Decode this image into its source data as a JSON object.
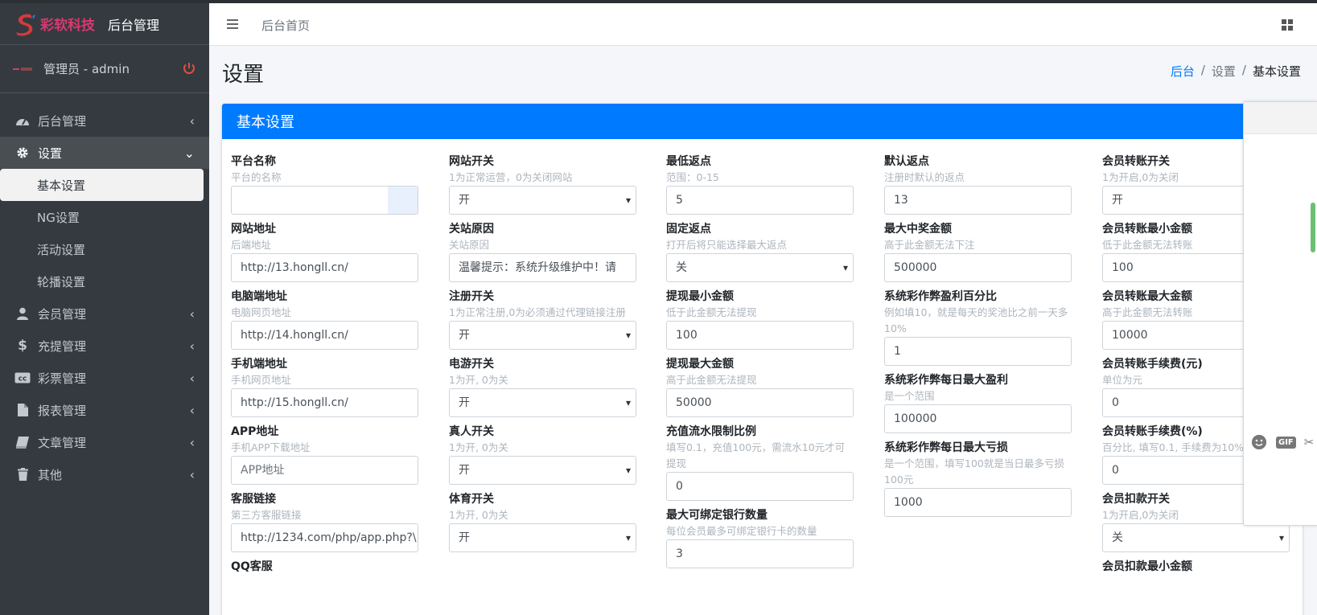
{
  "sidebar": {
    "brand_name": "彩软科技",
    "brand_sub": "后台管理",
    "user": "管理员 - admin",
    "menu": [
      {
        "label": "后台管理",
        "icon": "dashboard-icon"
      },
      {
        "label": "设置",
        "icon": "gear-icon"
      },
      {
        "label": "会员管理",
        "icon": "user-icon"
      },
      {
        "label": "充提管理",
        "icon": "dollar-icon"
      },
      {
        "label": "彩票管理",
        "icon": "cc-icon"
      },
      {
        "label": "报表管理",
        "icon": "file-icon"
      },
      {
        "label": "文章管理",
        "icon": "book-icon"
      },
      {
        "label": "其他",
        "icon": "trash-icon"
      }
    ],
    "submenu": [
      "基本设置",
      "NG设置",
      "活动设置",
      "轮播设置"
    ]
  },
  "navbar": {
    "home": "后台首页"
  },
  "page": {
    "title": "设置",
    "breadcrumb": [
      "后台",
      "设置",
      "基本设置"
    ],
    "card_title": "基本设置"
  },
  "form": {
    "col1": [
      {
        "label": "平台名称",
        "help": "平台的名称",
        "value": ""
      },
      {
        "label": "网站地址",
        "help": "后端地址",
        "value": "http://13.hongll.cn/"
      },
      {
        "label": "电脑端地址",
        "help": "电脑网页地址",
        "value": "http://14.hongll.cn/"
      },
      {
        "label": "手机端地址",
        "help": "手机网页地址",
        "value": "http://15.hongll.cn/"
      },
      {
        "label": "APP地址",
        "help": "手机APP下载地址",
        "placeholder": "APP地址"
      },
      {
        "label": "客服链接",
        "help": "第三方客服链接",
        "value": "http://1234.com/php/app.php?\\"
      },
      {
        "label": "QQ客服"
      }
    ],
    "col2": [
      {
        "label": "网站开关",
        "help": "1为正常运营，0为关闭网站",
        "value": "开"
      },
      {
        "label": "关站原因",
        "help": "关站原因",
        "value": "温馨提示：系统升级维护中！请"
      },
      {
        "label": "注册开关",
        "help": "1为正常注册,0为必须通过代理链接注册",
        "value": "开"
      },
      {
        "label": "电游开关",
        "help": "1为开, 0为关",
        "value": "开"
      },
      {
        "label": "真人开关",
        "help": "1为开, 0为关",
        "value": "开"
      },
      {
        "label": "体育开关",
        "help": "1为开, 0为关",
        "value": "开"
      }
    ],
    "col3": [
      {
        "label": "最低返点",
        "help": "范围：0-15",
        "value": "5"
      },
      {
        "label": "固定返点",
        "help": "打开后将只能选择最大返点",
        "value": "关"
      },
      {
        "label": "提现最小金额",
        "help": "低于此金额无法提现",
        "value": "100"
      },
      {
        "label": "提现最大金额",
        "help": "高于此金额无法提现",
        "value": "50000"
      },
      {
        "label": "充值流水限制比例",
        "help": "填写0.1，充值100元，需流水10元才可提现",
        "value": "0"
      },
      {
        "label": "最大可绑定银行数量",
        "help": "每位会员最多可绑定银行卡的数量",
        "value": "3"
      }
    ],
    "col4": [
      {
        "label": "默认返点",
        "help": "注册时默认的返点",
        "value": "13"
      },
      {
        "label": "最大中奖金额",
        "help": "高于此金额无法下注",
        "value": "500000"
      },
      {
        "label": "系统彩作弊盈利百分比",
        "help": "例如填10，就是每天的奖池比之前一天多10%",
        "value": "1"
      },
      {
        "label": "系统彩作弊每日最大盈利",
        "help": "是一个范围",
        "value": "100000"
      },
      {
        "label": "系统彩作弊每日最大亏损",
        "help": "是一个范围，填写100就是当日最多亏损100元",
        "value": "1000"
      }
    ],
    "col5": [
      {
        "label": "会员转账开关",
        "help": "1为开启,0为关闭",
        "value": "开"
      },
      {
        "label": "会员转账最小金额",
        "help": "低于此金额无法转账",
        "value": "100"
      },
      {
        "label": "会员转账最大金额",
        "help": "高于此金额无法转账",
        "value": "10000"
      },
      {
        "label": "会员转账手续费(元)",
        "help": "单位为元",
        "value": "0"
      },
      {
        "label": "会员转账手续费(%)",
        "help": "百分比, 填写0.1, 手续费为10%",
        "value": "0"
      },
      {
        "label": "会员扣款开关",
        "help": "1为开启,0为关闭",
        "value": "关"
      },
      {
        "label": "会员扣款最小金额"
      }
    ]
  },
  "floatpanel": {
    "gif_label": "GIF"
  },
  "colors": {
    "sidebar": "#343a40",
    "accent": "#007bff",
    "brand": "#d9396e"
  }
}
